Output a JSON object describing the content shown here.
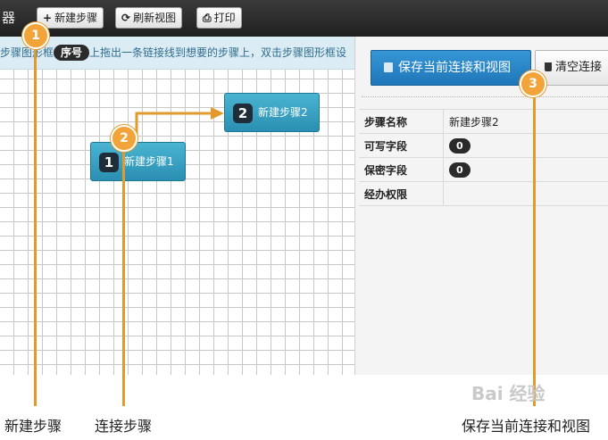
{
  "app": {
    "title_fragment": "器"
  },
  "toolbar": {
    "new_step": {
      "icon": "plus-icon",
      "label": "新建步骤"
    },
    "refresh": {
      "icon": "refresh-icon",
      "label": "刷新视图"
    },
    "print": {
      "icon": "printer-icon",
      "label": "打印"
    }
  },
  "hint": {
    "before": "步骤图形框",
    "pill": "序号",
    "after": "上拖出一条链接线到想要的步骤上，双击步骤图形框设"
  },
  "steps": [
    {
      "number": "1",
      "label": "新建步骤1"
    },
    {
      "number": "2",
      "label": "新建步骤2"
    }
  ],
  "panel": {
    "save_button": {
      "icon": "save-icon",
      "label": "保存当前连接和视图"
    },
    "clear_button": {
      "icon": "trash-icon",
      "label": "清空连接"
    },
    "properties": [
      {
        "key": "步骤名称",
        "value": "新建步骤2",
        "badge": false
      },
      {
        "key": "可写字段",
        "value": "0",
        "badge": true
      },
      {
        "key": "保密字段",
        "value": "0",
        "badge": true
      },
      {
        "key": "经办权限",
        "value": "",
        "badge": false
      }
    ]
  },
  "callouts": [
    {
      "number": "1",
      "caption": "新建步骤"
    },
    {
      "number": "2",
      "caption": "连接步骤"
    },
    {
      "number": "3",
      "caption": "保存当前连接和视图"
    }
  ],
  "watermark": "Bai 经验",
  "colors": {
    "accent_orange": "#e39a2c",
    "step_blue": "#2a8fb2",
    "save_blue": "#1f76b8",
    "toolbar_dark": "#2a2a2a"
  }
}
